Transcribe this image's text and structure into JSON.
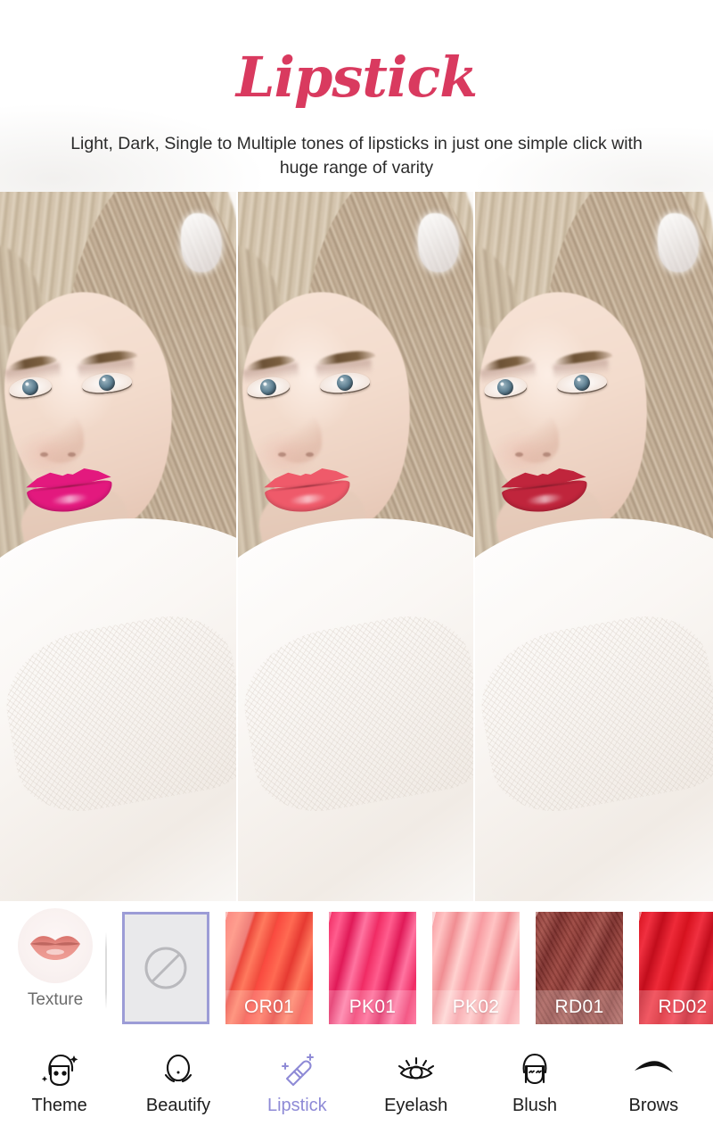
{
  "header": {
    "title": "Lipstick",
    "title_color": "#d93a5f",
    "subtitle": "Light, Dark, Single to Multiple tones of lipsticks in just one simple click with huge range of varity"
  },
  "preview": {
    "panes": [
      {
        "name": "preview-pane-1",
        "lip_color": "#e3197e",
        "lip_shade_name": "magenta-pink"
      },
      {
        "name": "preview-pane-2",
        "lip_color": "#ef5a6a",
        "lip_shade_name": "coral-pink"
      },
      {
        "name": "preview-pane-3",
        "lip_color": "#c0253c",
        "lip_shade_name": "crimson-red"
      }
    ]
  },
  "toolbar": {
    "texture": {
      "label": "Texture",
      "icon": "lips-icon"
    },
    "swatches": [
      {
        "id": "none",
        "label": "",
        "icon": "no-color-icon",
        "selected": true,
        "color": "#e9e9eb",
        "border": "#9c9cd6"
      },
      {
        "id": "OR01",
        "label": "OR01",
        "icon": "lipstick-swatch-icon",
        "selected": false,
        "color": "#f9483e"
      },
      {
        "id": "PK01",
        "label": "PK01",
        "icon": "lipstick-swatch-icon",
        "selected": false,
        "color": "#f02a63"
      },
      {
        "id": "PK02",
        "label": "PK02",
        "icon": "lipstick-swatch-icon",
        "selected": false,
        "color": "#f79aa0"
      },
      {
        "id": "RD01",
        "label": "RD01",
        "icon": "lipstick-swatch-icon",
        "selected": false,
        "color": "#8d3a36"
      },
      {
        "id": "RD02",
        "label": "RD02",
        "icon": "lipstick-swatch-icon",
        "selected": false,
        "color": "#d8121f"
      }
    ]
  },
  "bottom_nav": {
    "active_color": "#8e8ad6",
    "items": [
      {
        "label": "Theme",
        "icon": "theme-face-sparkle-icon",
        "active": false
      },
      {
        "label": "Beautify",
        "icon": "face-outline-icon",
        "active": false
      },
      {
        "label": "Lipstick",
        "icon": "lipstick-tube-icon",
        "active": true
      },
      {
        "label": "Eyelash",
        "icon": "eye-lashes-icon",
        "active": false
      },
      {
        "label": "Blush",
        "icon": "blush-face-icon",
        "active": false
      },
      {
        "label": "Brows",
        "icon": "eyebrow-icon",
        "active": false
      }
    ]
  }
}
